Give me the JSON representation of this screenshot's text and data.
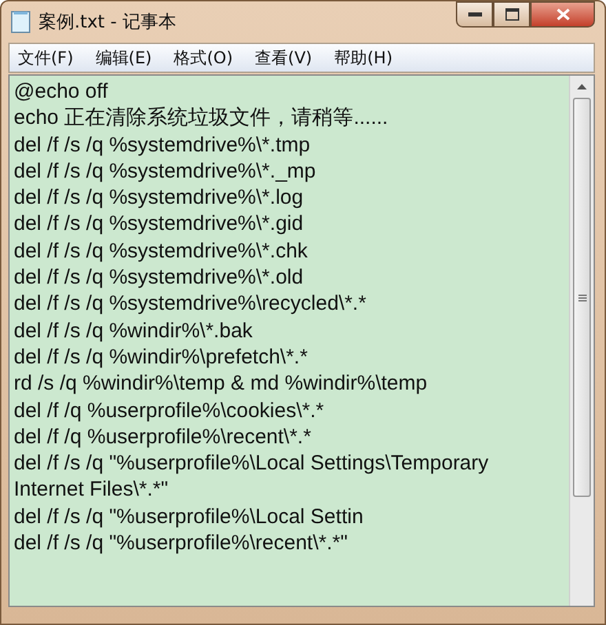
{
  "window": {
    "title": "案例.txt - 记事本"
  },
  "menu": [
    "文件(F)",
    "编辑(E)",
    "格式(O)",
    "查看(V)",
    "帮助(H)"
  ],
  "lines": [
    "@echo off",
    "echo 正在清除系统垃圾文件，请稍等......",
    "del /f /s /q %systemdrive%\\*.tmp",
    "del /f /s /q %systemdrive%\\*._mp",
    "del /f /s /q %systemdrive%\\*.log",
    "del /f /s /q %systemdrive%\\*.gid",
    "del /f /s /q %systemdrive%\\*.chk",
    "del /f /s /q %systemdrive%\\*.old",
    "del /f /s /q %systemdrive%\\recycled\\*.*",
    "del /f /s /q %windir%\\*.bak",
    "del /f /s /q %windir%\\prefetch\\*.*",
    "rd /s /q %windir%\\temp & md %windir%\\temp",
    "del /f /q %userprofile%\\cookies\\*.*",
    "del /f /q %userprofile%\\recent\\*.*",
    "del /f /s /q \"%userprofile%\\Local Settings\\Temporary",
    "Internet Files\\*.*\"",
    "del /f /s /q \"%userprofile%\\Local Settin",
    "del /f /s /q \"%userprofile%\\recent\\*.*\""
  ]
}
